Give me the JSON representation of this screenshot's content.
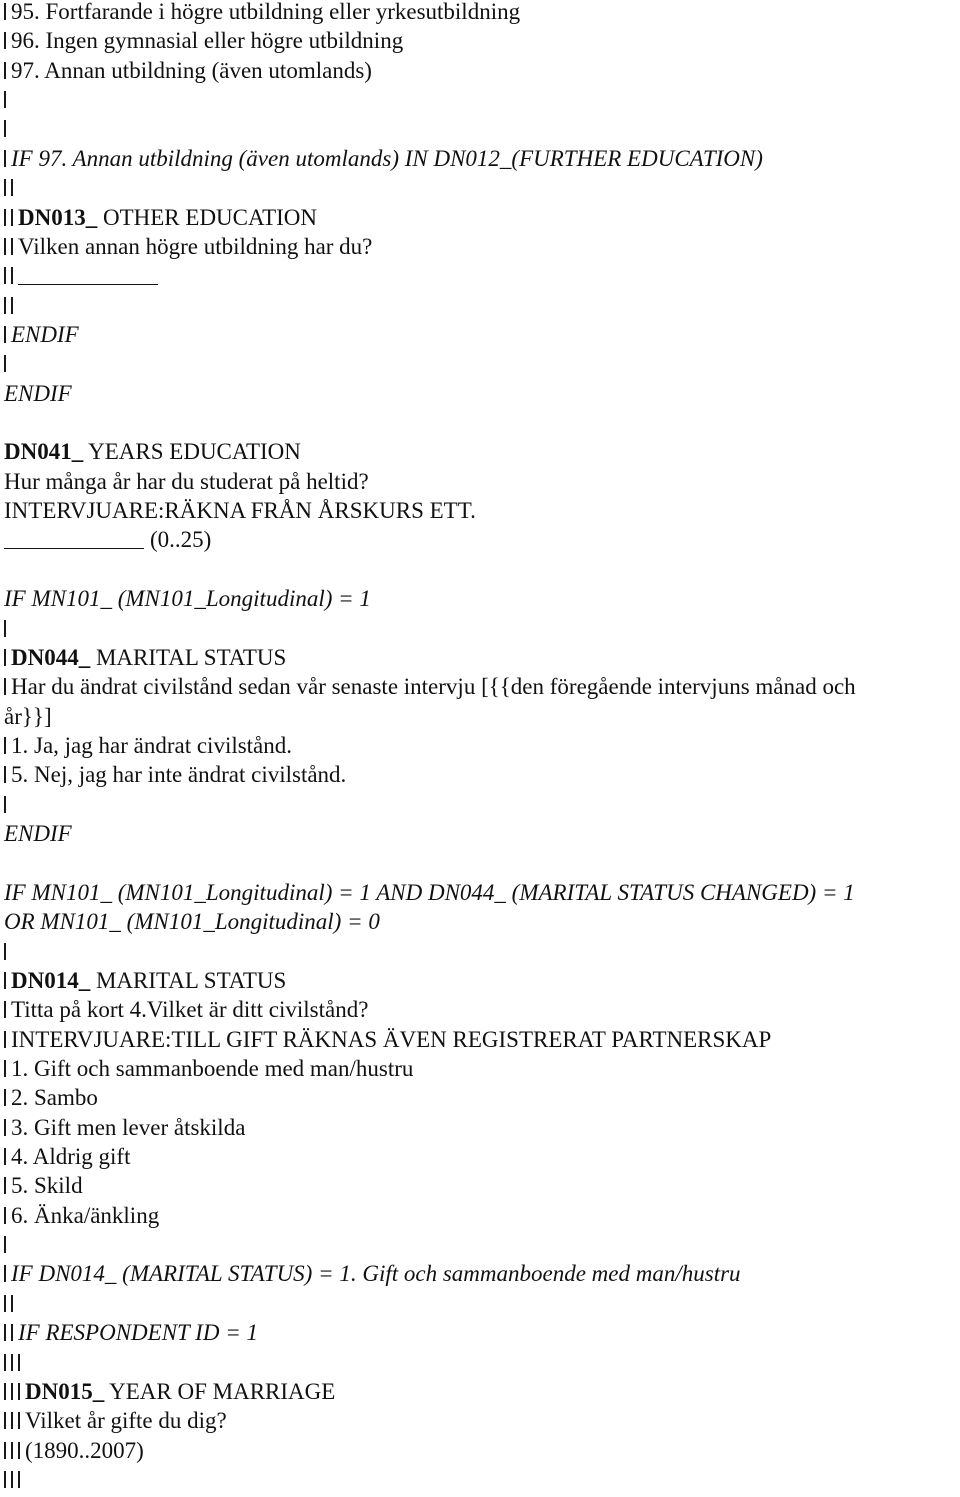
{
  "document": {
    "lines": [
      {
        "depth": 1,
        "segments": [
          {
            "text": "95. Fortfarande i högre utbildning eller yrkesutbildning"
          }
        ]
      },
      {
        "depth": 1,
        "segments": [
          {
            "text": "96. Ingen gymnasial eller högre utbildning"
          }
        ]
      },
      {
        "depth": 1,
        "segments": [
          {
            "text": "97. Annan utbildning (även utomlands)"
          }
        ]
      },
      {
        "depth": 1,
        "segments": []
      },
      {
        "depth": 1,
        "segments": []
      },
      {
        "depth": 1,
        "segments": [
          {
            "text": "IF 97. Annan utbildning (även utomlands) IN DN012_(FURTHER EDUCATION)",
            "style": "it"
          }
        ]
      },
      {
        "depth": 2,
        "segments": []
      },
      {
        "depth": 2,
        "segments": [
          {
            "text": "DN013_",
            "style": "b"
          },
          {
            "text": " OTHER EDUCATION"
          }
        ]
      },
      {
        "depth": 2,
        "segments": [
          {
            "text": "Vilken annan högre utbildning har du?"
          }
        ]
      },
      {
        "depth": 2,
        "segments": [
          {
            "field": true
          }
        ]
      },
      {
        "depth": 2,
        "segments": []
      },
      {
        "depth": 1,
        "segments": [
          {
            "text": "ENDIF",
            "style": "it"
          }
        ]
      },
      {
        "depth": 1,
        "segments": []
      },
      {
        "depth": 0,
        "segments": [
          {
            "text": "ENDIF",
            "style": "it"
          }
        ]
      },
      {
        "depth": 0,
        "segments": []
      },
      {
        "depth": 0,
        "segments": [
          {
            "text": "DN041_",
            "style": "b"
          },
          {
            "text": " YEARS EDUCATION"
          }
        ]
      },
      {
        "depth": 0,
        "segments": [
          {
            "text": "Hur många år har du studerat på heltid?"
          }
        ]
      },
      {
        "depth": 0,
        "segments": [
          {
            "text": "INTERVJUARE:RÄKNA FRÅN ÅRSKURS ETT."
          }
        ]
      },
      {
        "depth": 0,
        "segments": [
          {
            "field": true
          },
          {
            "text": "(0..25)"
          }
        ]
      },
      {
        "depth": 0,
        "segments": []
      },
      {
        "depth": 0,
        "segments": [
          {
            "text": "IF MN101_ (MN101_Longitudinal) = 1",
            "style": "it"
          }
        ]
      },
      {
        "depth": 1,
        "segments": []
      },
      {
        "depth": 1,
        "segments": [
          {
            "text": "DN044_",
            "style": "b"
          },
          {
            "text": " MARITAL STATUS"
          }
        ]
      },
      {
        "depth": 1,
        "segments": [
          {
            "text": "Har du ändrat civilstånd sedan vår senaste intervju [{{den föregående intervjuns månad och"
          }
        ]
      },
      {
        "depth": 0,
        "segments": [
          {
            "text": "år}}]"
          }
        ]
      },
      {
        "depth": 1,
        "segments": [
          {
            "text": "1. Ja, jag har ändrat civilstånd."
          }
        ]
      },
      {
        "depth": 1,
        "segments": [
          {
            "text": "5. Nej, jag har inte ändrat civilstånd."
          }
        ]
      },
      {
        "depth": 1,
        "segments": []
      },
      {
        "depth": 0,
        "segments": [
          {
            "text": "ENDIF",
            "style": "it"
          }
        ]
      },
      {
        "depth": 0,
        "segments": []
      },
      {
        "depth": 0,
        "segments": [
          {
            "text": "IF MN101_ (MN101_Longitudinal) = 1 AND DN044_ (MARITAL STATUS CHANGED) = 1",
            "style": "it"
          }
        ]
      },
      {
        "depth": 0,
        "segments": [
          {
            "text": "OR MN101_ (MN101_Longitudinal) = 0",
            "style": "it"
          }
        ]
      },
      {
        "depth": 1,
        "segments": []
      },
      {
        "depth": 1,
        "segments": [
          {
            "text": "DN014_",
            "style": "b"
          },
          {
            "text": " MARITAL STATUS"
          }
        ]
      },
      {
        "depth": 1,
        "segments": [
          {
            "text": "Titta på kort 4.Vilket är ditt civilstånd?"
          }
        ]
      },
      {
        "depth": 1,
        "segments": [
          {
            "text": "INTERVJUARE:TILL GIFT RÄKNAS ÄVEN REGISTRERAT PARTNERSKAP"
          }
        ]
      },
      {
        "depth": 1,
        "segments": [
          {
            "text": "1. Gift och sammanboende med man/hustru"
          }
        ]
      },
      {
        "depth": 1,
        "segments": [
          {
            "text": "2. Sambo"
          }
        ]
      },
      {
        "depth": 1,
        "segments": [
          {
            "text": "3. Gift men lever åtskilda"
          }
        ]
      },
      {
        "depth": 1,
        "segments": [
          {
            "text": "4. Aldrig gift"
          }
        ]
      },
      {
        "depth": 1,
        "segments": [
          {
            "text": "5. Skild"
          }
        ]
      },
      {
        "depth": 1,
        "segments": [
          {
            "text": "6. Änka/änkling"
          }
        ]
      },
      {
        "depth": 1,
        "segments": []
      },
      {
        "depth": 1,
        "segments": [
          {
            "text": "IF DN014_ (MARITAL STATUS) = 1. Gift och sammanboende med man/hustru",
            "style": "it"
          }
        ]
      },
      {
        "depth": 2,
        "segments": []
      },
      {
        "depth": 2,
        "segments": [
          {
            "text": "IF RESPONDENT ID = 1",
            "style": "it"
          }
        ]
      },
      {
        "depth": 3,
        "segments": []
      },
      {
        "depth": 3,
        "segments": [
          {
            "text": "DN015_",
            "style": "b"
          },
          {
            "text": " YEAR OF MARRIAGE"
          }
        ]
      },
      {
        "depth": 3,
        "segments": [
          {
            "text": "Vilket år gifte du dig?"
          }
        ]
      },
      {
        "depth": 3,
        "segments": [
          {
            "text": "(1890..2007)"
          }
        ]
      },
      {
        "depth": 3,
        "segments": []
      }
    ]
  }
}
